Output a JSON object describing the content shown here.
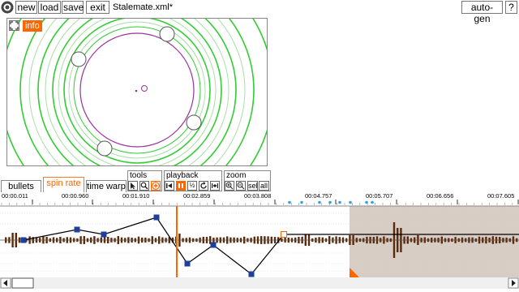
{
  "toolbar": {
    "new_label": "new",
    "load_label": "load",
    "save_label": "save",
    "exit_label": "exit",
    "filename": "Stalemate.xml*",
    "autogen_label": "auto-gen",
    "help_label": "?"
  },
  "preview": {
    "info_label": "info"
  },
  "tabs": [
    {
      "label": "bullets"
    },
    {
      "label": "spin rate"
    },
    {
      "label": "time warp"
    }
  ],
  "tools": {
    "label": "tools"
  },
  "playback": {
    "label": "playback",
    "half_label": "½"
  },
  "zoom": {
    "label": "zoom",
    "sel_label": "sel",
    "all_label": "all"
  },
  "ruler": {
    "ticks": [
      "00:00.011",
      "00:00.960",
      "00:01.910",
      "00:02.859",
      "00:03.808",
      "00:04.757",
      "00:05.707",
      "00:06.656",
      "00:07.605"
    ]
  },
  "colors": {
    "accent": "#ff6600",
    "point": "#1f3f9c",
    "bar": "#5a2a0a",
    "selection": "#d8cdc4",
    "rings": "#33cc33",
    "orbit": "#993399"
  }
}
